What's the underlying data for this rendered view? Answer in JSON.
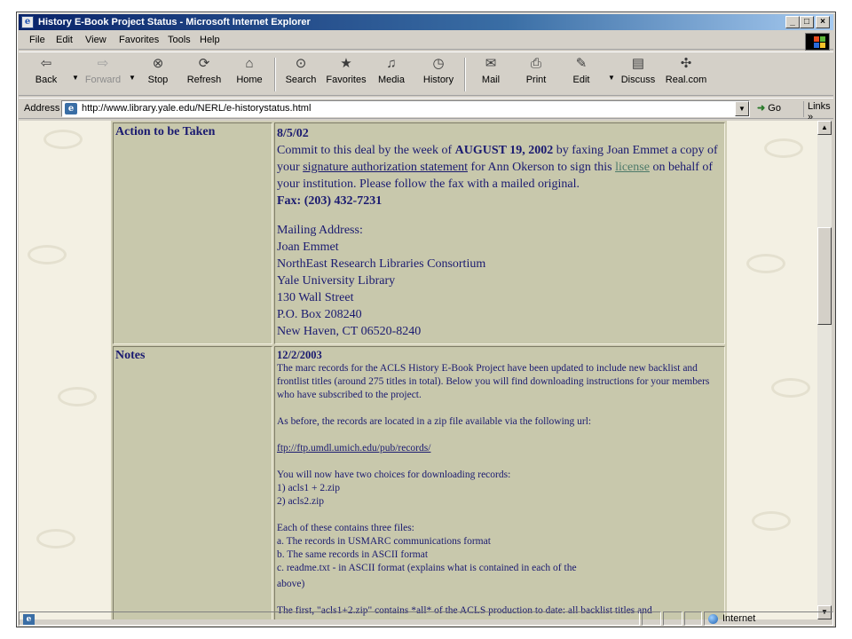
{
  "window": {
    "title": "History E-Book Project Status - Microsoft Internet Explorer",
    "controls": {
      "minimize": "_",
      "maximize": "□",
      "close": "×"
    }
  },
  "menu": {
    "items": [
      {
        "label": "File",
        "icon": ""
      },
      {
        "label": "Edit"
      },
      {
        "label": "View"
      },
      {
        "label": "Favorites"
      },
      {
        "label": "Tools"
      },
      {
        "label": "Help"
      }
    ]
  },
  "toolbar": {
    "back": "Back",
    "forward": "Forward",
    "stop": "Stop",
    "refresh": "Refresh",
    "home": "Home",
    "search": "Search",
    "favorites": "Favorites",
    "media": "Media",
    "history": "History",
    "mail": "Mail",
    "print": "Print",
    "edit": "Edit",
    "discuss": "Discuss",
    "realcom": "Real.com",
    "icons": {
      "back": "back-arrow-icon",
      "forward": "forward-arrow-icon",
      "stop": "stop-icon",
      "refresh": "refresh-icon",
      "home": "home-icon",
      "search": "search-icon",
      "favorites": "favorites-icon",
      "media": "media-icon",
      "history": "history-icon",
      "mail": "mail-icon",
      "print": "printer-icon",
      "edit": "edit-icon",
      "discuss": "discuss-icon",
      "realcom": "realcom-icon"
    }
  },
  "address": {
    "label": "Address",
    "url": "http://www.library.yale.edu/NERL/e-historystatus.html",
    "go": "Go",
    "links": "Links"
  },
  "content": {
    "row1": {
      "label": "Action to be Taken",
      "date": "8/5/02",
      "commit_pre": "Commit to this deal by the week of ",
      "commit_date": "AUGUST 19, 2002",
      "commit_mid": " by faxing Joan Emmet a copy of your ",
      "sig_link": "signature authorization statement",
      "commit_mid2": " for Ann Okerson to sign this ",
      "license_link": "license",
      "commit_post": " on behalf of your institution. Please follow the fax with a mailed original.",
      "fax": "Fax: (203) 432-7231",
      "mailing_label": "Mailing Address:",
      "address_lines": [
        "Joan Emmet",
        "NorthEast Research Libraries Consortium",
        "Yale University Library",
        "130 Wall Street",
        "P.O. Box 208240",
        "New Haven, CT 06520-8240"
      ]
    },
    "row2": {
      "label": "Notes",
      "date": "12/2/2003",
      "p1": "The marc records for the ACLS History E-Book Project have been updated to include new backlist and frontlist titles (around 275 titles in total). Below you will find downloading instructions for your members who have subscribed to the project.",
      "p2": "As before, the records are located in a zip file available via the following url:",
      "ftp_link": "ftp://ftp.umdl.umich.edu/pub/records/",
      "p3": "You will now have two choices for downloading records:",
      "choice1": "1) acls1 + 2.zip",
      "choice2": "2) acls2.zip",
      "p4": "Each of these contains three files:",
      "file_a": "a. The records in USMARC communications format",
      "file_b": "b. The same records in ASCII format",
      "file_c": "c. readme.txt - in ASCII format (explains what is contained in each of the",
      "file_c2": "above)",
      "p5": "The first, \"acls1+2.zip\" contains *all* of the ACLS production to date: all backlist titles and"
    }
  },
  "status": {
    "zone": "Internet"
  },
  "colors": {
    "titlebar_start": "#0a246a",
    "titlebar_end": "#a6caf0",
    "chrome": "#d4d0c8",
    "page_bg": "#f3f0e3",
    "cell_bg": "#c8c8ac",
    "text": "#1a1a70",
    "visited_link": "#4d7a6a"
  }
}
